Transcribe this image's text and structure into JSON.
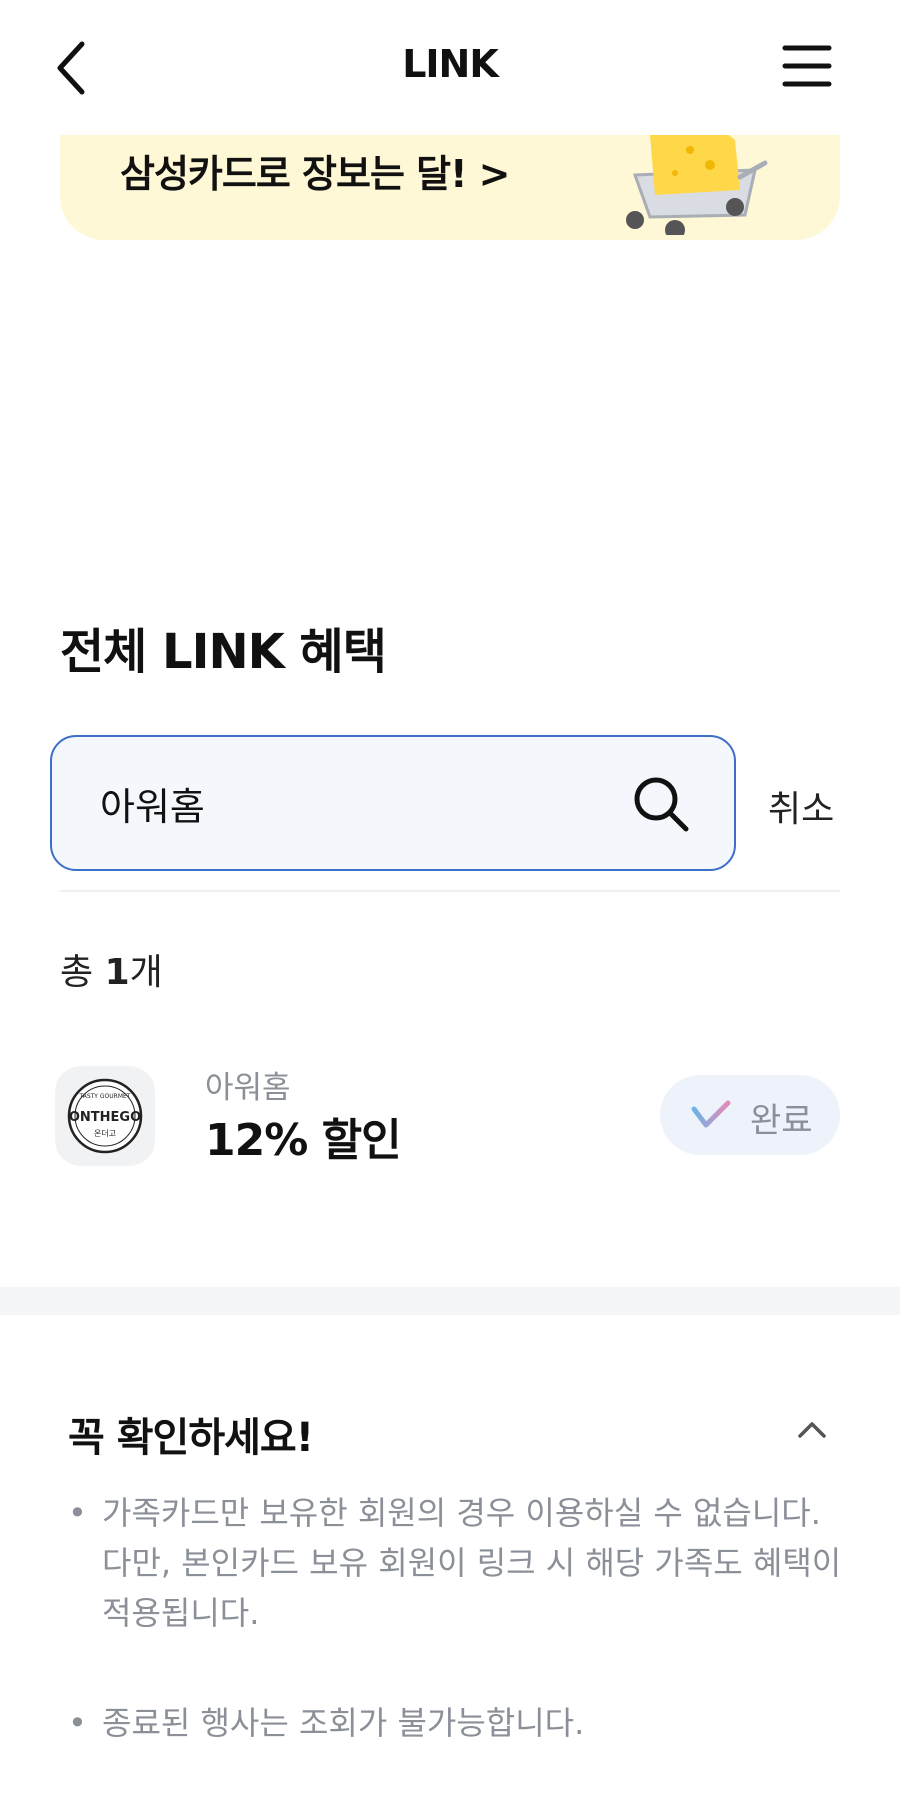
{
  "header": {
    "title": "LINK"
  },
  "banner": {
    "text": "삼성카드로 장보는 달! >"
  },
  "section": {
    "title": "전체 LINK 혜택"
  },
  "search": {
    "value": "아워홈",
    "cancel_label": "취소"
  },
  "results": {
    "count_prefix": "총 ",
    "count": "1",
    "count_suffix": "개",
    "items": [
      {
        "store_name": "아워홈",
        "benefit": "12% 할인",
        "status_label": "완료",
        "logo_text": "ONTHEGO",
        "logo_subtext": "온더고",
        "logo_ring_text": "TASTY GOURMET"
      }
    ]
  },
  "notice": {
    "title": "꼭 확인하세요!",
    "items": [
      "가족카드만 보유한 회원의 경우 이용하실 수 없습니다. 다만, 본인카드 보유 회원이 링크 시 해당 가족도 혜택이 적용됩니다.",
      "종료된 행사는 조회가 불가능합니다."
    ]
  },
  "colors": {
    "search_border": "#3e6fc8",
    "banner_bg": "#fff8d6",
    "done_bg": "#eef3fb",
    "muted_text": "#8a8f98"
  }
}
